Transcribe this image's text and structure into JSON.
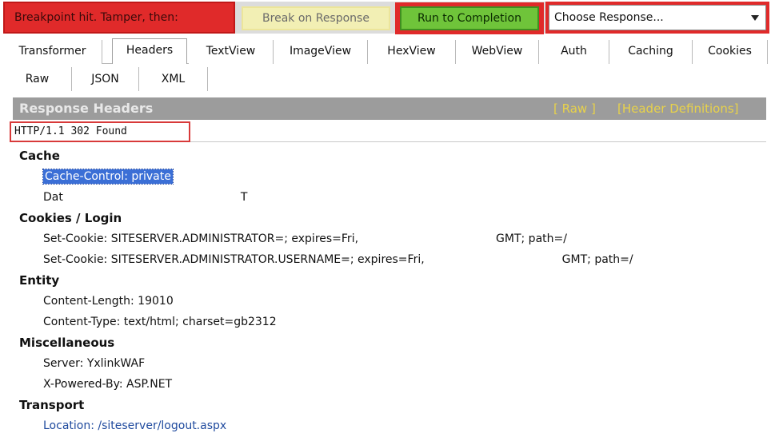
{
  "breakpoint_bar": {
    "message": "Breakpoint hit. Tamper, then:",
    "break_on_response_label": "Break on Response",
    "run_to_completion_label": "Run to Completion",
    "choose_response": {
      "selected_value": "Choose Response..."
    }
  },
  "tabs": [
    {
      "label": "Transformer",
      "active": false
    },
    {
      "label": "Headers",
      "active": true
    },
    {
      "label": "TextView",
      "active": false
    },
    {
      "label": "ImageView",
      "active": false
    },
    {
      "label": "HexView",
      "active": false
    },
    {
      "label": "WebView",
      "active": false
    },
    {
      "label": "Auth",
      "active": false
    },
    {
      "label": "Caching",
      "active": false
    },
    {
      "label": "Cookies",
      "active": false
    }
  ],
  "subtabs": [
    {
      "label": "Raw"
    },
    {
      "label": "JSON"
    },
    {
      "label": "XML"
    }
  ],
  "response_headers": {
    "title": "Response Headers",
    "raw_link": "[ Raw ]",
    "definitions_link": "[Header Definitions]",
    "status_line": "HTTP/1.1 302 Found"
  },
  "groups": {
    "cache": {
      "label": "Cache",
      "items": [
        "Cache-Control: private",
        "Dat",
        "T"
      ]
    },
    "cookies": {
      "label": "Cookies / Login",
      "items": [
        "Set-Cookie: SITESERVER.ADMINISTRATOR=; expires=Fri,",
        "GMT; path=/",
        "Set-Cookie: SITESERVER.ADMINISTRATOR.USERNAME=; expires=Fri,",
        "GMT; path=/"
      ]
    },
    "entity": {
      "label": "Entity",
      "items": [
        "Content-Length: 19010",
        "Content-Type: text/html; charset=gb2312"
      ]
    },
    "misc": {
      "label": "Miscellaneous",
      "items": [
        "Server: YxlinkWAF",
        "X-Powered-By: ASP.NET"
      ]
    },
    "transport": {
      "label": "Transport",
      "items": [
        "Location: /siteserver/logout.aspx"
      ]
    }
  },
  "colors": {
    "alert_red": "#e02a2a",
    "break_btn_bg": "#f2efb4",
    "run_btn_bg": "#6fc43a",
    "header_band": "#9c9c9c",
    "header_link": "#e8d24a",
    "selection": "#3b6fd6",
    "link_text": "#1f4a9e"
  }
}
